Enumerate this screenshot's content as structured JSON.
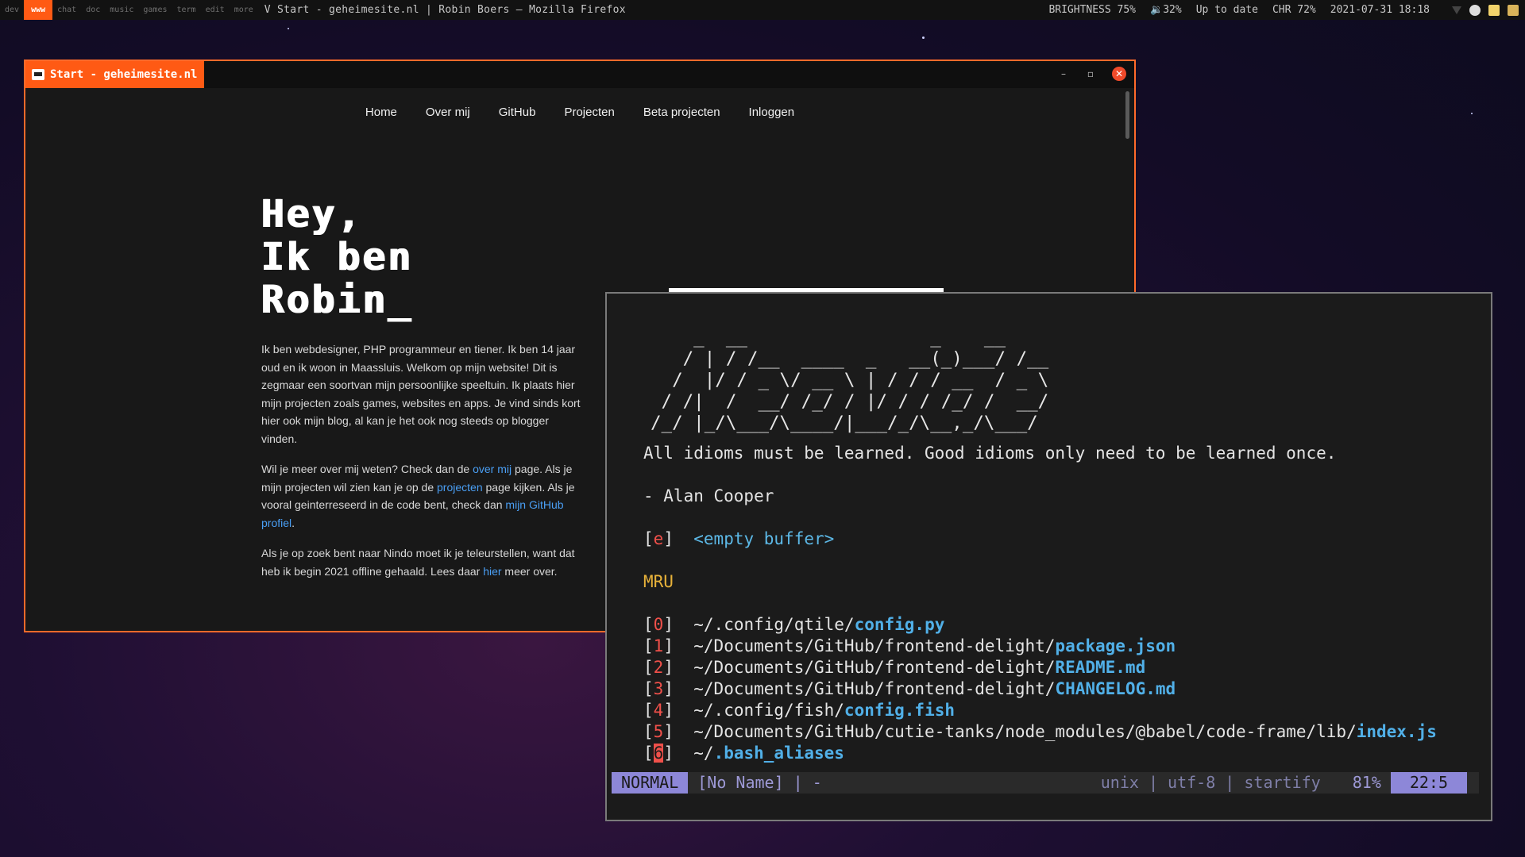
{
  "topbar": {
    "workspaces": [
      "dev",
      "www",
      "chat",
      "doc",
      "music",
      "games",
      "term",
      "edit",
      "more"
    ],
    "active_workspace": "www",
    "window_title": "V Start - geheimesite.nl | Robin Boers — Mozilla Firefox",
    "brightness": "BRIGHTNESS 75%",
    "volume": "🔉32%",
    "updates": "Up to date",
    "battery": "CHR 72%",
    "datetime": "2021-07-31 18:18"
  },
  "browser": {
    "tab_title": "Start - geheimesite.nl",
    "minimize": "–",
    "maximize": "▫",
    "close": "✕",
    "nav": [
      "Home",
      "Over mij",
      "GitHub",
      "Projecten",
      "Beta projecten",
      "Inloggen"
    ],
    "hero": [
      "Hey,",
      "Ik ben",
      "Robin_"
    ],
    "p1": "Ik ben webdesigner, PHP programmeur en tiener. Ik ben 14 jaar oud en ik woon in Maassluis. Welkom op mijn website! Dit is zegmaar een soortvan mijn persoonlijke speeltuin. Ik plaats hier mijn projecten zoals games, websites en apps. Je vind sinds kort hier ook mijn blog, al kan je het ook nog steeds op blogger vinden.",
    "p2_a": "Wil je meer over mij weten? Check dan de ",
    "p2_link1": "over mij",
    "p2_b": " page. Als je mijn projecten wil zien kan je op de ",
    "p2_link2": "projecten",
    "p2_c": " page kijken. Als je vooral geinterreseerd in de code bent, check dan ",
    "p2_link3": "mijn GitHub profiel",
    "p2_d": ".",
    "p3_a": "Als je op zoek bent naar Nindo moet ik je teleurstellen, want dat heb ik begin 2021 offline gehaald. Lees daar ",
    "p3_link": "hier",
    "p3_b": " meer over."
  },
  "vim": {
    "ascii_art": "    _  __                 _    __\n   / | / /__  ____  _   __(_)___/ /__\n  /  |/ / _ \\/ __ \\ | / / / __  / _ \\\n / /|  /  __/ /_/ / |/ / / /_/ /  __/\n/_/ |_/\\___/\\____/|___/_/\\__,_/\\___/",
    "quote": "All idioms must be learned. Good idioms only need to be learned once.",
    "author": "- Alan Cooper",
    "empty_key": "e",
    "empty_label": "<empty buffer>",
    "mru_heading": "MRU",
    "mru": [
      {
        "idx": "0",
        "dir": "~/.config/qtile/",
        "file": "config.py"
      },
      {
        "idx": "1",
        "dir": "~/Documents/GitHub/frontend-delight/",
        "file": "package.json"
      },
      {
        "idx": "2",
        "dir": "~/Documents/GitHub/frontend-delight/",
        "file": "README.md"
      },
      {
        "idx": "3",
        "dir": "~/Documents/GitHub/frontend-delight/",
        "file": "CHANGELOG.md"
      },
      {
        "idx": "4",
        "dir": "~/.config/fish/",
        "file": "config.fish"
      },
      {
        "idx": "5",
        "dir": "~/Documents/GitHub/cutie-tanks/node_modules/@babel/code-frame/lib/",
        "file": "index.js"
      },
      {
        "idx": "6",
        "dir": "~/",
        "file": ".bash_aliases"
      }
    ],
    "status": {
      "mode": "NORMAL",
      "buffer": "[No Name] | -",
      "info": "unix | utf-8 | startify",
      "percent": "81%",
      "position": "22:5"
    }
  },
  "colors": {
    "accent": "#ff5a14",
    "link": "#4a9ff5",
    "vim_index": "#f0504a",
    "vim_file": "#51b0e8",
    "vim_mru": "#e8b23a",
    "vim_mode": "#8d87d8"
  }
}
